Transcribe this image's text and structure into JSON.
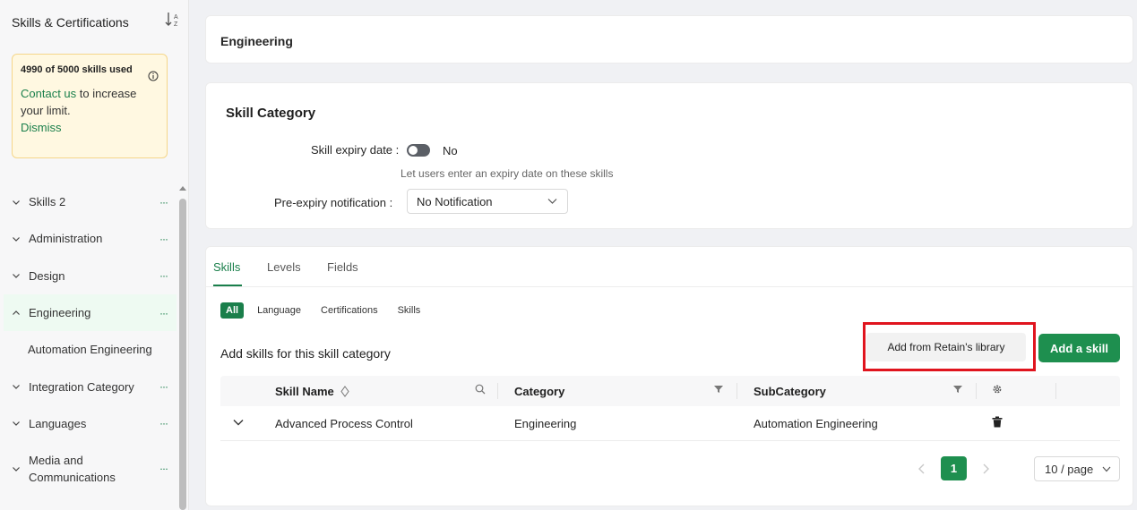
{
  "sidebar": {
    "title": "Skills & Certifications",
    "quota": {
      "used": "4990 of 5000 skills used",
      "contact_link": "Contact us",
      "contact_rest": " to increase your limit.",
      "dismiss": "Dismiss"
    },
    "items": [
      {
        "label": "Skills 2",
        "expanded": false
      },
      {
        "label": "Administration",
        "expanded": false
      },
      {
        "label": "Design",
        "expanded": false
      },
      {
        "label": "Engineering",
        "expanded": true
      },
      {
        "label": "Automation Engineering",
        "sub": true
      },
      {
        "label": "Integration Category",
        "expanded": false
      },
      {
        "label": "Languages",
        "expanded": false
      },
      {
        "label": "Media and Communications",
        "expanded": false
      }
    ],
    "dots": "···"
  },
  "header": {
    "title": "Engineering"
  },
  "category": {
    "title": "Skill Category",
    "expiry_label": "Skill expiry date",
    "expiry_value": "No",
    "expiry_hint": "Let users enter an expiry date on these skills",
    "notification_label": "Pre-expiry notification",
    "notification_value": "No Notification"
  },
  "tabs": [
    {
      "label": "Skills",
      "active": true
    },
    {
      "label": "Levels",
      "active": false
    },
    {
      "label": "Fields",
      "active": false
    }
  ],
  "filters": [
    "All",
    "Language",
    "Certifications",
    "Skills"
  ],
  "skills_section": {
    "title": "Add skills for this skill category",
    "library_button": "Add from Retain's library",
    "add_button": "Add a skill"
  },
  "table": {
    "columns": [
      "Skill Name",
      "Category",
      "SubCategory"
    ],
    "rows": [
      {
        "name": "Advanced Process Control",
        "category": "Engineering",
        "subcategory": "Automation Engineering"
      }
    ]
  },
  "pagination": {
    "current": "1",
    "page_size": "10 / page"
  },
  "colors": {
    "accent": "#1a7f4b",
    "highlight": "#e0141e",
    "quota_bg": "#fff8e1"
  }
}
